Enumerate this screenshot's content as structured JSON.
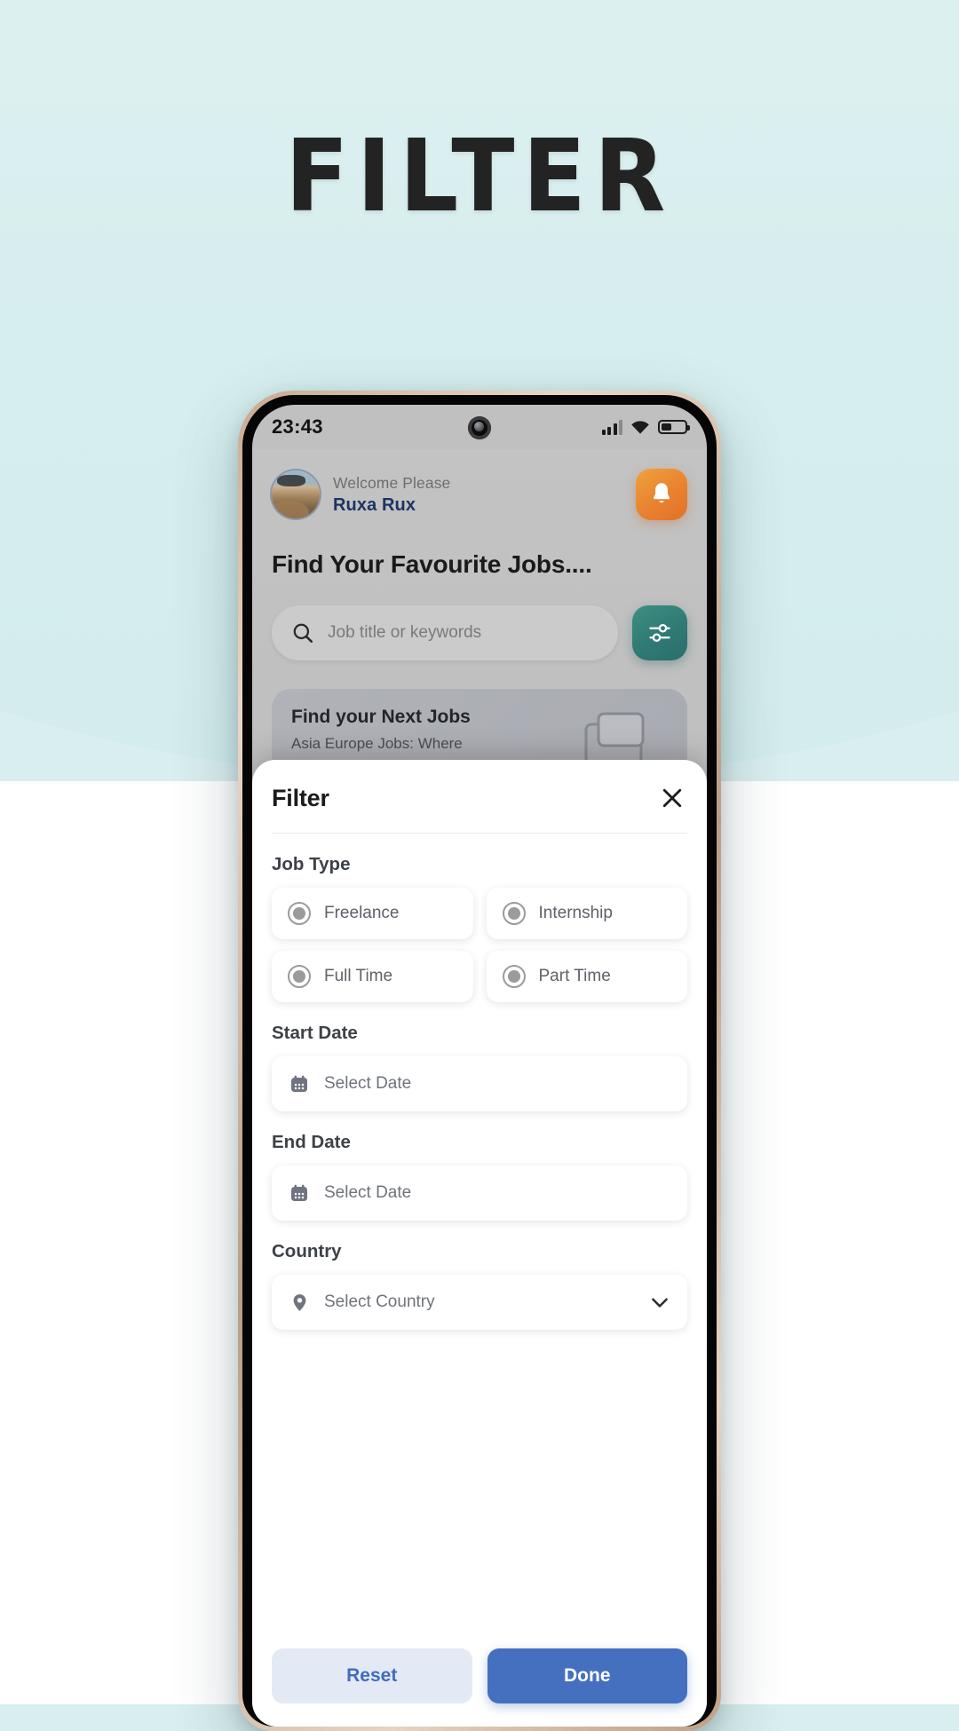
{
  "hero": {
    "title": "FILTER"
  },
  "statusbar": {
    "time": "23:43",
    "icons": {
      "signal": "signal-bars-icon",
      "wifi": "wifi-icon",
      "battery": "battery-icon",
      "camera": "front-camera-punchhole-icon"
    }
  },
  "app": {
    "welcome_label": "Welcome Please",
    "user_name": "Ruxa Rux",
    "notification_icon": "bell-icon",
    "avatar_icon": "avatar",
    "headline": "Find Your Favourite Jobs....",
    "search": {
      "placeholder": "Job title or keywords",
      "icon": "search-icon"
    },
    "filter_button_icon": "sliders-filter-icon",
    "promo": {
      "title": "Find your Next Jobs",
      "subtitle": "Asia Europe Jobs: Where",
      "art_icon": "folder-documents-icon"
    }
  },
  "sheet": {
    "title": "Filter",
    "close_icon": "close-icon",
    "sections": {
      "job_type": {
        "label": "Job Type",
        "options": [
          {
            "label": "Freelance",
            "icon": "radio-icon"
          },
          {
            "label": "Internship",
            "icon": "radio-icon"
          },
          {
            "label": "Full Time",
            "icon": "radio-icon"
          },
          {
            "label": "Part Time",
            "icon": "radio-icon"
          }
        ]
      },
      "start_date": {
        "label": "Start Date",
        "placeholder": "Select Date",
        "icon": "calendar-icon"
      },
      "end_date": {
        "label": "End Date",
        "placeholder": "Select Date",
        "icon": "calendar-icon"
      },
      "country": {
        "label": "Country",
        "placeholder": "Select Country",
        "icon": "location-pin-icon",
        "chevron": "chevron-down-icon"
      }
    },
    "actions": {
      "reset_label": "Reset",
      "done_label": "Done"
    }
  },
  "colors": {
    "page_bg": "#d9eeee",
    "title": "#232323",
    "accent_blue": "#4470bf",
    "reset_bg": "#e4eaf5",
    "user_name": "#1d3461",
    "filter_teal": "#2f7a74",
    "bell_orange": "#e98230"
  }
}
